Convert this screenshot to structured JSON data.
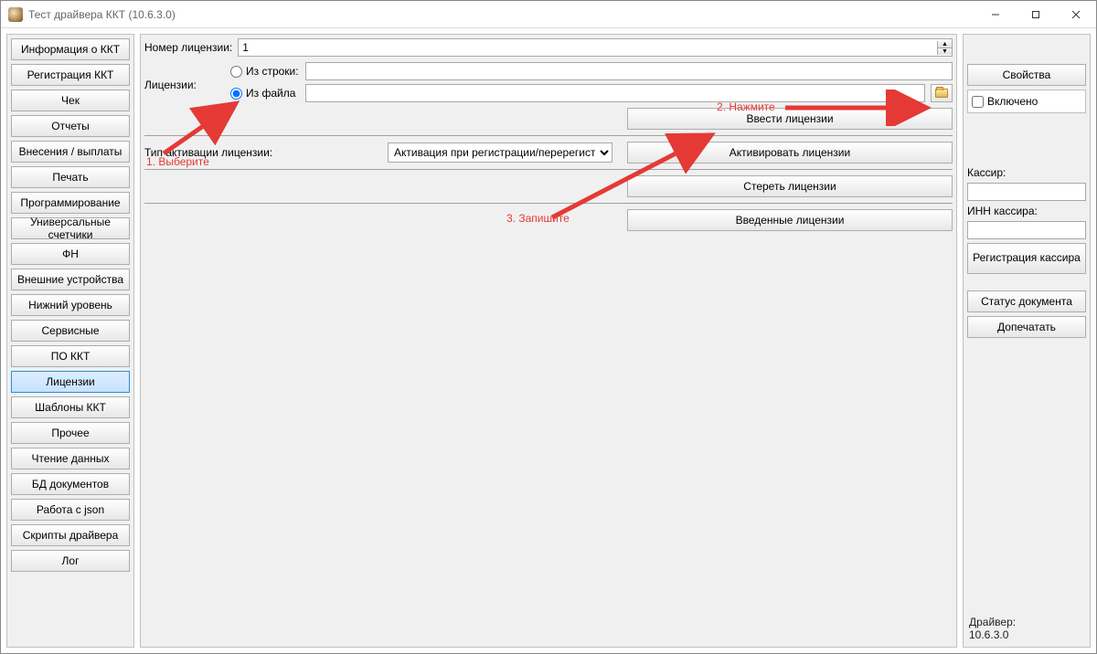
{
  "window": {
    "title": "Тест драйвера ККТ (10.6.3.0)"
  },
  "sidebar": {
    "items": [
      "Информация о ККТ",
      "Регистрация ККТ",
      "Чек",
      "Отчеты",
      "Внесения / выплаты",
      "Печать",
      "Программирование",
      "Универсальные счетчики",
      "ФН",
      "Внешние устройства",
      "Нижний уровень",
      "Сервисные",
      "ПО ККТ",
      "Лицензии",
      "Шаблоны ККТ",
      "Прочее",
      "Чтение данных",
      "БД документов",
      "Работа с json",
      "Скрипты драйвера",
      "Лог"
    ],
    "selected_index": 13
  },
  "main": {
    "license_number_label": "Номер лицензии:",
    "license_number_value": "1",
    "licenses_label": "Лицензии:",
    "radio_from_string": "Из строки:",
    "radio_from_file": "Из файла",
    "radio_selected": "from_file",
    "from_string_value": "",
    "from_file_value": "",
    "activation_type_label": "Тип активации лицензии:",
    "activation_type_value": "Активация при регистрации/перерегистрации",
    "buttons": {
      "enter": "Ввести лицензии",
      "activate": "Активировать лицензии",
      "erase": "Стереть лицензии",
      "entered": "Введенные лицензии"
    },
    "annotations": {
      "a1": "1. Выберите",
      "a2": "2. Нажмите",
      "a3": "3. Запишите"
    }
  },
  "rightpanel": {
    "properties": "Свойства",
    "enabled_label": "Включено",
    "enabled_checked": false,
    "cashier_label": "Кассир:",
    "cashier_value": "",
    "inn_label": "ИНН кассира:",
    "inn_value": "",
    "register_cashier": "Регистрация кассира",
    "doc_status": "Статус документа",
    "reprint": "Допечатать",
    "driver_label": "Драйвер:",
    "driver_version": "10.6.3.0"
  }
}
